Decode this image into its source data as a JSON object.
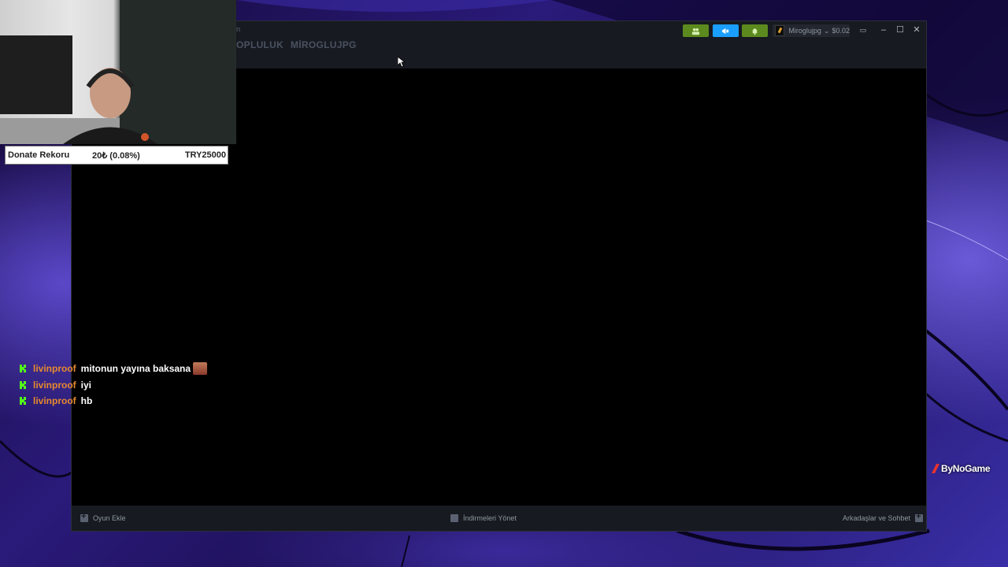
{
  "titlebar": {
    "menu_items": [
      "OPLULUK",
      "MİROGLUJPG"
    ],
    "title_fragment": "n",
    "account_name": "Miroglujpg",
    "wallet": "$0.02",
    "icons": [
      "friends-icon",
      "announcement-icon",
      "notification-icon"
    ],
    "colors": {
      "friends": "#5c8a1e",
      "announce": "#1a9fff",
      "notify": "#5c8a1e"
    }
  },
  "statusbar": {
    "add_game": "Oyun Ekle",
    "downloads": "İndirmeleri Yönet",
    "friends_chat": "Arkadaşlar ve Sohbet"
  },
  "overlay": {
    "donate_label": "Donate Rekoru",
    "donate_amount": "20₺ (0.08%)",
    "donate_goal": "TRY25000"
  },
  "chat": [
    {
      "user": "livinproof",
      "message": "mitonun yayına baksana"
    },
    {
      "user": "livinproof",
      "message": "iyi"
    },
    {
      "user": "livinproof",
      "message": "hb"
    }
  ],
  "watermark": "ByNoGame"
}
